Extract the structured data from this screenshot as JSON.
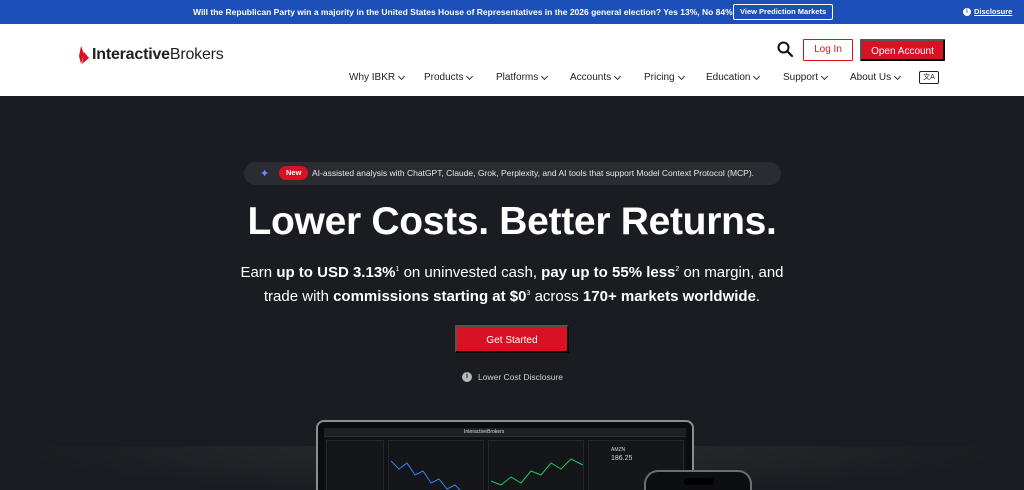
{
  "banner": {
    "text": "Will the Republican Party win a majority in the United States House of Representatives in the 2026 general election?  Yes 13%, No 84%",
    "button_label": "View Prediction Markets",
    "disclosure_label": "Disclosure"
  },
  "header": {
    "logo_bold": "Interactive",
    "logo_rest": "Brokers",
    "login_label": "Log In",
    "open_account_label": "Open Account",
    "language_label": "文A"
  },
  "nav": {
    "items": [
      {
        "label": "Why IBKR"
      },
      {
        "label": "Products"
      },
      {
        "label": "Platforms"
      },
      {
        "label": "Accounts"
      },
      {
        "label": "Pricing"
      },
      {
        "label": "Education"
      },
      {
        "label": "Support"
      },
      {
        "label": "About Us"
      }
    ]
  },
  "hero": {
    "badge": "New",
    "announcement": "AI-assisted analysis with ChatGPT, Claude, Grok, Perplexity, and AI tools that support Model Context Protocol (MCP).",
    "title": "Lower Costs. Better Returns.",
    "sub1_a": "Earn ",
    "sub1_b": "up to USD 3.13%",
    "sub1_sup1": "1",
    "sub1_c": " on uninvested cash, ",
    "sub1_d": "pay up to 55% less",
    "sub1_sup2": "2",
    "sub1_e": " on margin, and",
    "sub2_a": "trade with ",
    "sub2_b": "commissions starting at $0",
    "sub2_sup": "3",
    "sub2_c": " across ",
    "sub2_d": "170+ markets worldwide",
    "sub2_e": ".",
    "cta_label": "Get Started",
    "disclosure_label": "Lower Cost Disclosure"
  },
  "mockup": {
    "brand": "InteractiveBrokers",
    "ticker_symbol": "AMZN",
    "ticker_price": "186.25"
  },
  "colors": {
    "banner_blue": "#1d4fb8",
    "brand_red": "#d81222",
    "hero_bg": "#1b1c21"
  }
}
